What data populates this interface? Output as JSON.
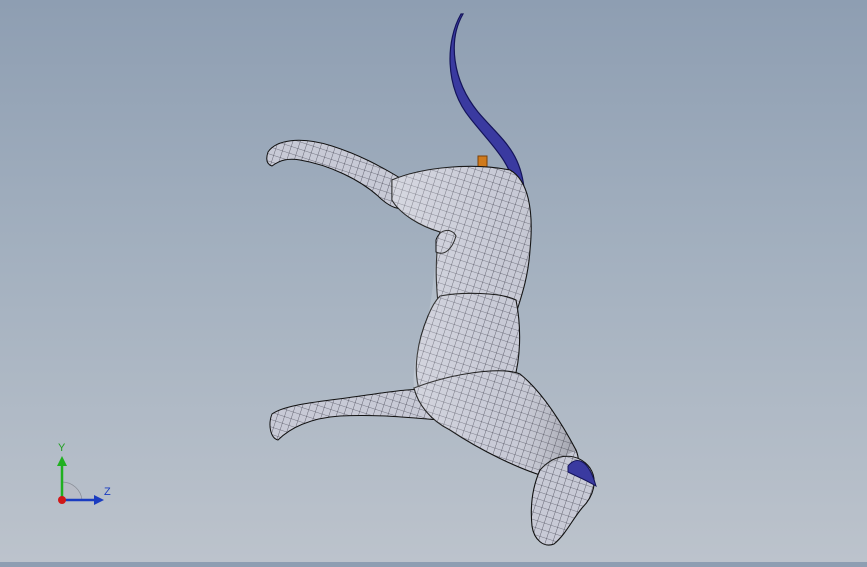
{
  "model": {
    "name_icon": "cat-wireframe-model",
    "body_fill": "#c9cbd6",
    "mesh_color": "#1b1b2a",
    "tail_color": "#2a2a8c",
    "pin_color": "#d07a1c"
  },
  "triad": {
    "y_label": "Y",
    "z_label": "Z",
    "y_color": "#20b020",
    "z_color": "#1a3cc0",
    "origin_color": "#d01818"
  }
}
